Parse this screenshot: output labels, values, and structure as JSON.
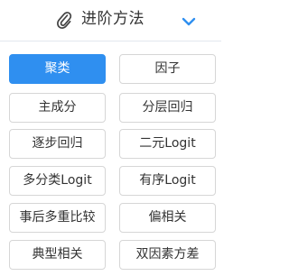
{
  "header": {
    "title": "进阶方法",
    "left_icon": "paperclip-icon",
    "right_icon": "chevron-down-icon",
    "accent_color": "#2f8ff0"
  },
  "methods": [
    {
      "label": "聚类",
      "active": true
    },
    {
      "label": "因子",
      "active": false
    },
    {
      "label": "主成分",
      "active": false
    },
    {
      "label": "分层回归",
      "active": false
    },
    {
      "label": "逐步回归",
      "active": false
    },
    {
      "label": "二元Logit",
      "active": false
    },
    {
      "label": "多分类Logit",
      "active": false
    },
    {
      "label": "有序Logit",
      "active": false
    },
    {
      "label": "事后多重比较",
      "active": false
    },
    {
      "label": "偏相关",
      "active": false
    },
    {
      "label": "典型相关",
      "active": false
    },
    {
      "label": "双因素方差",
      "active": false
    }
  ]
}
